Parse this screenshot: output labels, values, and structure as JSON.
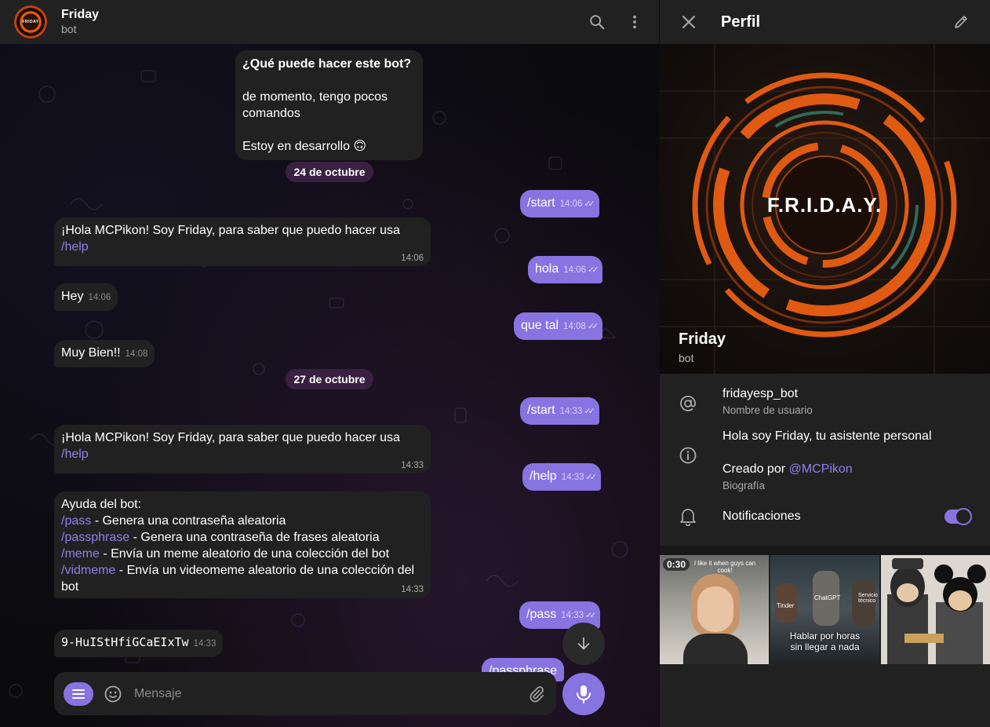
{
  "chat": {
    "title": "Friday",
    "subtitle": "bot",
    "avatar_text": "FRIDAY",
    "composer_placeholder": "Mensaje"
  },
  "messages": {
    "intro": {
      "heading": "¿Qué puede hacer este bot?",
      "line1": "de momento, tengo pocos",
      "line2": "comandos",
      "line3": "Estoy en desarrollo 🙃"
    },
    "date1": "24 de octubre",
    "m1": {
      "text": "/start",
      "time": "14:06"
    },
    "m2": {
      "text": "¡Hola MCPikon! Soy Friday, para saber que puedo hacer usa ",
      "cmd": "/help",
      "time": "14:06"
    },
    "m3": {
      "text": "hola",
      "time": "14:06"
    },
    "m4": {
      "text": "Hey",
      "time": "14:06"
    },
    "m5": {
      "text": "que tal",
      "time": "14:08"
    },
    "m6": {
      "text": "Muy Bien!!",
      "time": "14:08"
    },
    "date2": "27 de octubre",
    "m7": {
      "text": "/start",
      "time": "14:33"
    },
    "m8": {
      "text": "¡Hola MCPikon! Soy Friday, para saber que puedo hacer usa ",
      "cmd": "/help",
      "time": "14:33"
    },
    "m9": {
      "text": "/help",
      "time": "14:33"
    },
    "m10": {
      "title": "Ayuda del bot:",
      "c1": "/pass",
      "d1": " - Genera una contraseña aleatoria",
      "c2": "/passphrase",
      "d2": " - Genera una contraseña de frases aleatoria",
      "c3": "/meme",
      "d3": " - Envía un meme aleatorio de una colección del bot",
      "c4": "/vidmeme",
      "d4": " - Envía un videomeme aleatorio de una colección del",
      "d4b": "bot",
      "time": "14:33"
    },
    "m11": {
      "text": "/pass",
      "time": "14:33"
    },
    "m12": {
      "text": "9-HuIStHfiGCaEIxTw",
      "time": "14:33"
    },
    "m13": {
      "text": "/passphrase"
    }
  },
  "profile": {
    "title": "Perfil",
    "logo_text": "F.R.I.D.A.Y.",
    "name": "Friday",
    "sub": "bot",
    "username": "fridayesp_bot",
    "username_label": "Nombre de usuario",
    "bio_line1": "Hola soy Friday, tu asistente personal",
    "bio_line2_prefix": "Creado por ",
    "bio_mention": "@MCPikon",
    "bio_label": "Biografía",
    "notifications": "Notificaciones",
    "notifications_on": true
  },
  "media": {
    "video_duration": "0:30",
    "video_caption": "I like it when guys can cook!",
    "meme2_labels": [
      "Tinder",
      "ChatGPT",
      "Servicio técnico"
    ],
    "meme2_caption_1": "Hablar por horas",
    "meme2_caption_2": "sin llegar a nada"
  },
  "colors": {
    "accent": "#8774e1",
    "panel": "#212121",
    "orange": "#e05a12"
  }
}
